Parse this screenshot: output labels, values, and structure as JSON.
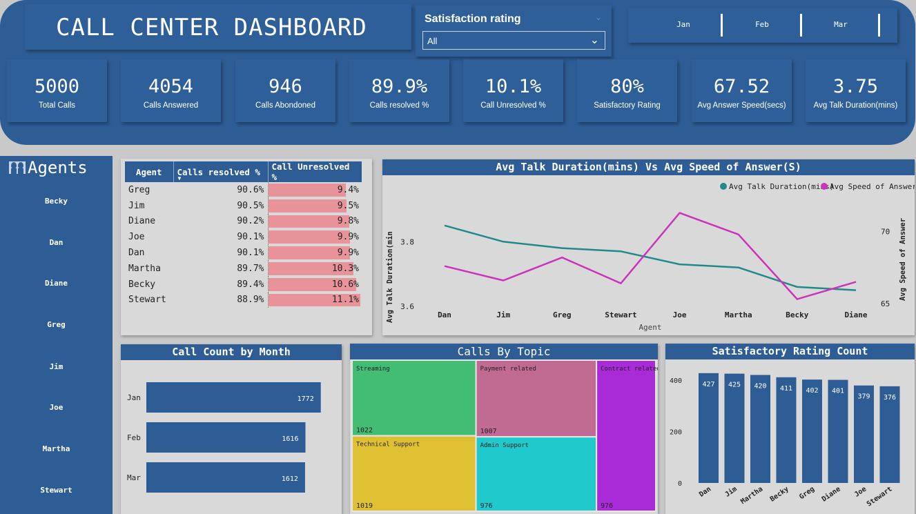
{
  "header": {
    "title": "CALL CENTER DASHBOARD",
    "slicer": {
      "label": "Satisfaction rating",
      "value": "All"
    },
    "months": [
      "Jan",
      "Feb",
      "Mar"
    ]
  },
  "kpis": [
    {
      "value": "5000",
      "label": "Total Calls"
    },
    {
      "value": "4054",
      "label": "Calls Answered"
    },
    {
      "value": "946",
      "label": "Calls Abondoned"
    },
    {
      "value": "89.9%",
      "label": "Calls resolved %"
    },
    {
      "value": "10.1%",
      "label": "Call Unresolved %"
    },
    {
      "value": "80%",
      "label": "Satisfactory Rating"
    },
    {
      "value": "67.52",
      "label": "Avg Answer Speed(secs)"
    },
    {
      "value": "3.75",
      "label": "Avg Talk Duration(mins)"
    }
  ],
  "agents_panel": {
    "title": "Agents",
    "items": [
      "Becky",
      "Dan",
      "Diane",
      "Greg",
      "Jim",
      "Joe",
      "Martha",
      "Stewart"
    ]
  },
  "agent_table": {
    "headers": [
      "Agent",
      "Calls resolved %",
      "Call Unresolved %"
    ],
    "rows": [
      {
        "agent": "Greg",
        "resolved": "90.6%",
        "unresolved": "9.4%",
        "unresolved_value": 9.4
      },
      {
        "agent": "Jim",
        "resolved": "90.5%",
        "unresolved": "9.5%",
        "unresolved_value": 9.5
      },
      {
        "agent": "Diane",
        "resolved": "90.2%",
        "unresolved": "9.8%",
        "unresolved_value": 9.8
      },
      {
        "agent": "Joe",
        "resolved": "90.1%",
        "unresolved": "9.9%",
        "unresolved_value": 9.9
      },
      {
        "agent": "Dan",
        "resolved": "90.1%",
        "unresolved": "9.9%",
        "unresolved_value": 9.9
      },
      {
        "agent": "Martha",
        "resolved": "89.7%",
        "unresolved": "10.3%",
        "unresolved_value": 10.3
      },
      {
        "agent": "Becky",
        "resolved": "89.4%",
        "unresolved": "10.6%",
        "unresolved_value": 10.6
      },
      {
        "agent": "Stewart",
        "resolved": "88.9%",
        "unresolved": "11.1%",
        "unresolved_value": 11.1
      }
    ],
    "bar_color": "#e8939a"
  },
  "chart_data": [
    {
      "type": "line",
      "title": "Avg Talk Duration(mins) Vs Avg Speed of Answer(S)",
      "xlabel": "Agent",
      "categories": [
        "Dan",
        "Jim",
        "Greg",
        "Stewart",
        "Joe",
        "Martha",
        "Becky",
        "Diane"
      ],
      "series": [
        {
          "name": "Avg Talk Duration(mins)",
          "axis": "left",
          "color": "#1f8a8c",
          "values": [
            3.85,
            3.8,
            3.78,
            3.77,
            3.73,
            3.72,
            3.66,
            3.65
          ]
        },
        {
          "name": "Avg Speed of Answer",
          "axis": "right",
          "color": "#cc33bb",
          "values": [
            67.6,
            66.6,
            68.2,
            66.4,
            71.3,
            69.8,
            65.3,
            66.5
          ]
        }
      ],
      "y_left": {
        "label": "Avg Talk Duration(min",
        "ticks": [
          3.6,
          3.8
        ],
        "lim": [
          3.6,
          3.92
        ]
      },
      "y_right": {
        "label": "Avg Speed of Answer",
        "ticks": [
          65,
          70
        ],
        "lim": [
          64.8,
          72
        ]
      },
      "legend": "top-right"
    },
    {
      "type": "bar",
      "orientation": "horizontal",
      "title": "Call Count by Month",
      "categories": [
        "Jan",
        "Feb",
        "Mar"
      ],
      "values": [
        1772,
        1616,
        1612
      ],
      "color": "#2e5d96",
      "xlim": [
        0,
        1900
      ]
    },
    {
      "type": "treemap",
      "title": "Calls By Topic",
      "items": [
        {
          "name": "Streaming",
          "value": 1022,
          "color": "#43bd74"
        },
        {
          "name": "Technical Support",
          "value": 1019,
          "color": "#e0c033"
        },
        {
          "name": "Payment related",
          "value": 1007,
          "color": "#c16a92"
        },
        {
          "name": "Admin Support",
          "value": 976,
          "color": "#1fc9cc"
        },
        {
          "name": "Contract related",
          "value": 976,
          "color": "#a92bd8"
        }
      ]
    },
    {
      "type": "bar",
      "title": "Satisfactory Rating Count",
      "categories": [
        "Dan",
        "Jim",
        "Martha",
        "Becky",
        "Greg",
        "Diane",
        "Joe",
        "Stewart"
      ],
      "values": [
        427,
        425,
        420,
        411,
        402,
        401,
        379,
        376
      ],
      "y_ticks": [
        0,
        200,
        400
      ],
      "ylim": [
        0,
        440
      ],
      "color": "#2e5d96"
    }
  ]
}
